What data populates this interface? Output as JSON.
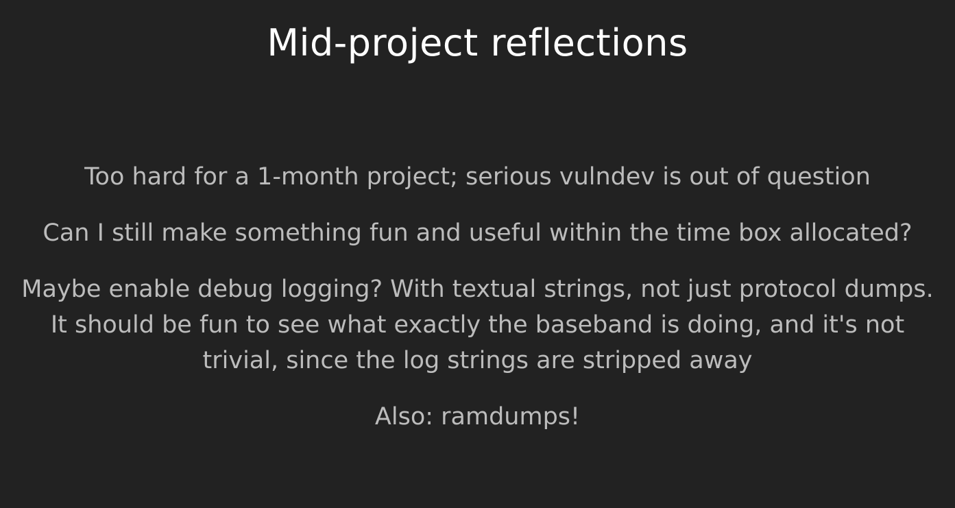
{
  "slide": {
    "title": "Mid-project reflections",
    "paragraphs": [
      "Too hard for a 1-month project; serious vulndev is out of question",
      "Can I still make something fun and useful within the time box allocated?",
      "Maybe enable debug logging? With textual strings, not just protocol dumps. It should be fun to see what exactly the baseband is doing, and it's not trivial, since the log strings are stripped away",
      "Also: ramdumps!"
    ]
  }
}
